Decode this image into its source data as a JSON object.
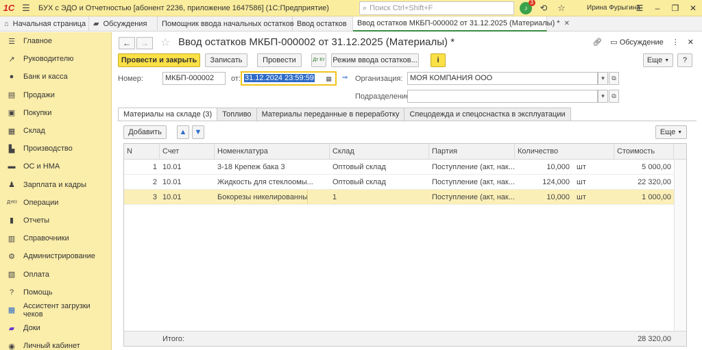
{
  "app": {
    "title": "БУХ с ЭДО и Отчетностью [абонент 2236, приложение 1647586]  (1С:Предприятие)",
    "search_placeholder": "Поиск Ctrl+Shift+F",
    "notifications_count": "3",
    "user": "Ирина Фурыгина"
  },
  "tabs": [
    {
      "label": "Начальная страница"
    },
    {
      "label": "Обсуждения"
    },
    {
      "label": "Помощник ввода начальных остатков"
    },
    {
      "label": "Ввод остатков"
    },
    {
      "label": "Ввод остатков МКБП-000002 от 31.12.2025 (Материалы) *"
    }
  ],
  "sidebar": [
    {
      "label": "Главное",
      "icon": "menu-icon"
    },
    {
      "label": "Руководителю",
      "icon": "trend-icon"
    },
    {
      "label": "Банк и касса",
      "icon": "coins-icon"
    },
    {
      "label": "Продажи",
      "icon": "cart-icon"
    },
    {
      "label": "Покупки",
      "icon": "bag-icon"
    },
    {
      "label": "Склад",
      "icon": "warehouse-icon"
    },
    {
      "label": "Производство",
      "icon": "factory-icon"
    },
    {
      "label": "ОС и НМА",
      "icon": "truck-icon"
    },
    {
      "label": "Зарплата и кадры",
      "icon": "person-icon"
    },
    {
      "label": "Операции",
      "icon": "dt-kt-icon"
    },
    {
      "label": "Отчеты",
      "icon": "chart-icon"
    },
    {
      "label": "Справочники",
      "icon": "book-icon"
    },
    {
      "label": "Администрирование",
      "icon": "gear-icon"
    },
    {
      "label": "Оплата",
      "icon": "payment-icon"
    },
    {
      "label": "Помощь",
      "icon": "question-icon"
    },
    {
      "label": "Ассистент загрузки чеков",
      "icon": "grid-icon"
    },
    {
      "label": "Доки",
      "icon": "docs-icon"
    },
    {
      "label": "Личный кабинет",
      "icon": "user-circle-icon"
    }
  ],
  "document": {
    "title": "Ввод остатков МКБП-000002 от 31.12.2025 (Материалы) *",
    "discussion": "Обсуждение",
    "toolbar": {
      "post_close": "Провести и закрыть",
      "save": "Записать",
      "post": "Провести",
      "dtkt": "Дт Кт",
      "mode": "Режим ввода остатков...",
      "more": "Еще",
      "help": "?"
    },
    "number_label": "Номер:",
    "number_value": "МКБП-000002",
    "date_label": "от:",
    "date_value": "31.12.2024 23:59:59",
    "org_label": "Организация:",
    "org_value": "МОЯ КОМПАНИЯ ООО",
    "subdiv_label": "Подразделение:",
    "subdiv_value": ""
  },
  "inner_tabs": [
    {
      "label": "Материалы на складе (3)"
    },
    {
      "label": "Топливо"
    },
    {
      "label": "Материалы переданные в переработку"
    },
    {
      "label": "Спецодежда и спецоснастка в эксплуатации"
    }
  ],
  "table_toolbar": {
    "add": "Добавить",
    "more": "Еще"
  },
  "table": {
    "columns": [
      "N",
      "Счет",
      "Номенклатура",
      "Склад",
      "Партия",
      "Количество",
      "Стоимость"
    ],
    "rows": [
      {
        "n": "1",
        "account": "10.01",
        "item": "3-18 Крепеж бака 3",
        "warehouse": "Оптовый склад",
        "batch": "Поступление (акт, нак...",
        "qty": "10,000",
        "unit": "шт",
        "cost": "5 000,00"
      },
      {
        "n": "2",
        "account": "10.01",
        "item": "Жидкость для стеклоомы...",
        "warehouse": "Оптовый склад",
        "batch": "Поступление (акт, нак...",
        "qty": "124,000",
        "unit": "шт",
        "cost": "22 320,00"
      },
      {
        "n": "3",
        "account": "10.01",
        "item": "Бокорезы никелированные",
        "warehouse": "1",
        "batch": "Поступление (акт, нак...",
        "qty": "10,000",
        "unit": "шт",
        "cost": "1 000,00"
      }
    ],
    "total_label": "Итого:",
    "total_value": "28 320,00"
  }
}
